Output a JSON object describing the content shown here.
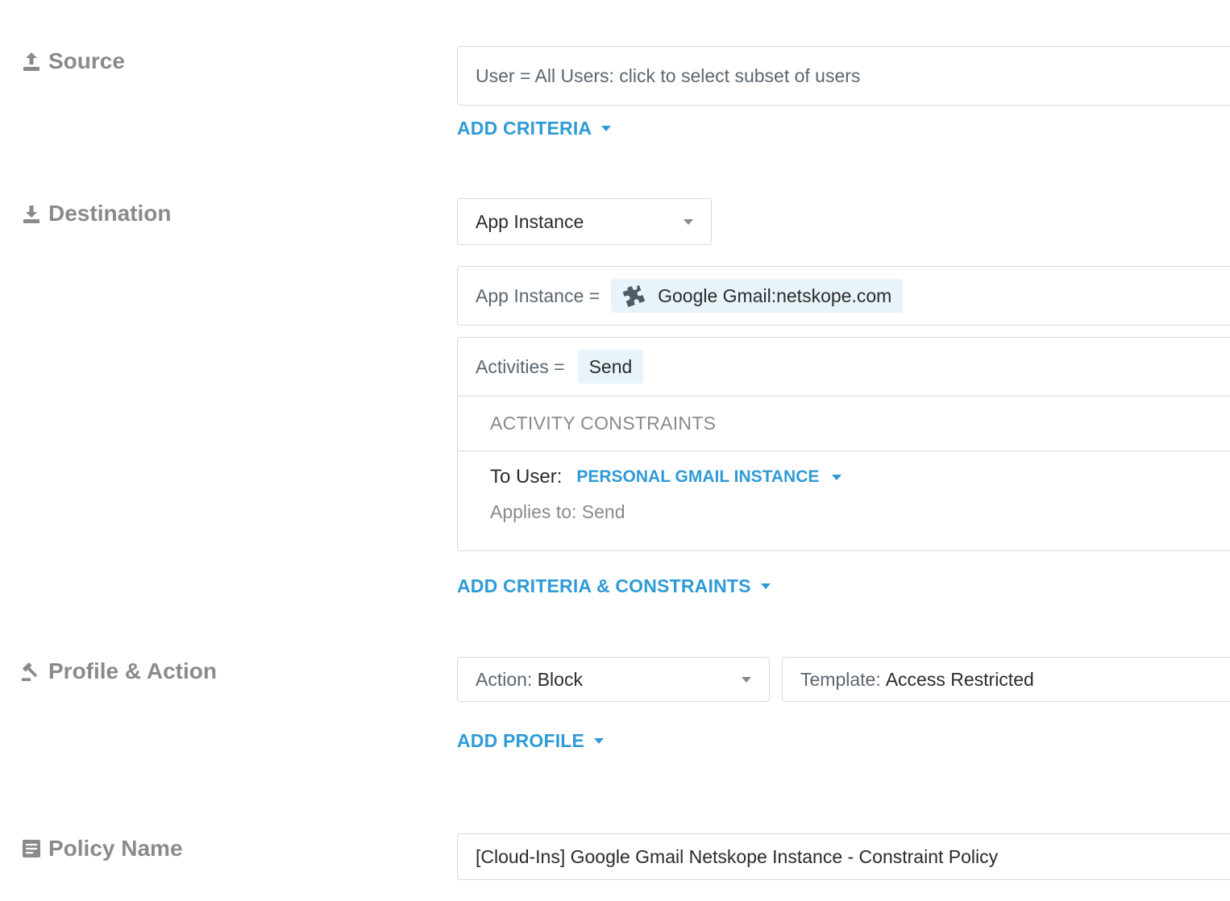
{
  "source": {
    "label": "Source",
    "user_field": "User = All Users: click to select subset of users",
    "add_criteria": "ADD CRITERIA"
  },
  "destination": {
    "label": "Destination",
    "type_select": "App Instance",
    "app_instance": {
      "prefix": "App Instance =",
      "chip": "Google Gmail:netskope.com"
    },
    "activities": {
      "prefix": "Activities =",
      "chip": "Send"
    },
    "constraints": {
      "header": "ACTIVITY CONSTRAINTS",
      "to_user_label": "To User:",
      "to_user_value": "PERSONAL GMAIL INSTANCE",
      "applies_to": "Applies to: Send"
    },
    "add_criteria_constraints": "ADD CRITERIA & CONSTRAINTS"
  },
  "profile_action": {
    "label": "Profile & Action",
    "action_prefix": "Action:",
    "action_value": "Block",
    "template_prefix": "Template:",
    "template_value": "Access Restricted",
    "add_profile": "ADD PROFILE"
  },
  "policy_name": {
    "label": "Policy Name",
    "value": "[Cloud-Ins] Google Gmail Netskope Instance - Constraint Policy"
  },
  "colors": {
    "link": "#2e9bd6",
    "label_grey": "#8a8a8a",
    "chip_bg": "#e8f4fa",
    "border": "#d9d9d9"
  },
  "icons": {
    "source": "upload-icon",
    "destination": "download-icon",
    "profile_action": "gavel-icon",
    "policy_name": "document-icon",
    "app": "puzzle-icon"
  }
}
